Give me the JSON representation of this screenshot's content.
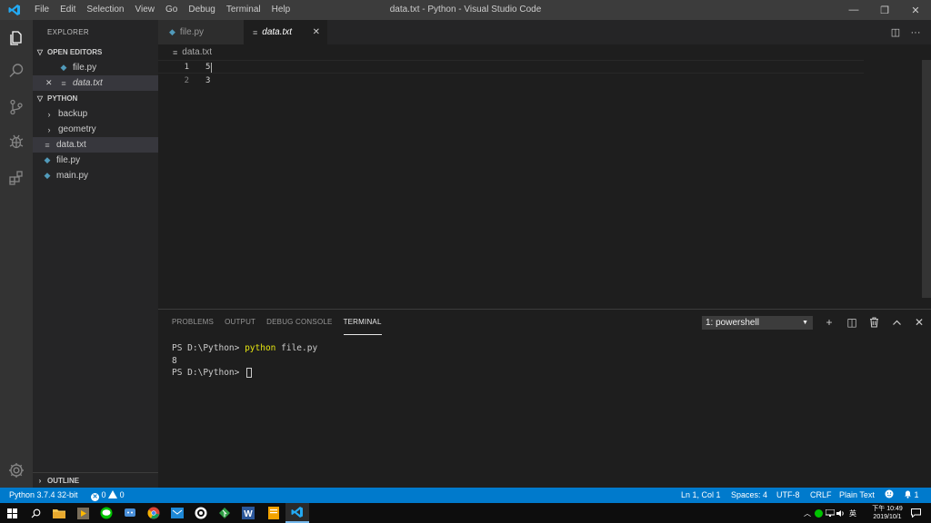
{
  "titlebar": {
    "menu": [
      "File",
      "Edit",
      "Selection",
      "View",
      "Go",
      "Debug",
      "Terminal",
      "Help"
    ],
    "title": "data.txt - Python - Visual Studio Code",
    "min_glyph": "—",
    "restore_glyph": "❐",
    "close_glyph": "✕",
    "logo_icon": "vscode-logo-icon"
  },
  "activitybar": {
    "items": [
      "explorer-icon",
      "search-icon",
      "source-control-icon",
      "debug-icon",
      "extensions-icon"
    ],
    "bottom": "gear-icon"
  },
  "sidebar": {
    "title": "EXPLORER",
    "open_editors": {
      "header": "OPEN EDITORS",
      "items": [
        {
          "name": "file.py",
          "icon": "python-file-icon"
        },
        {
          "name": "data.txt",
          "icon": "text-file-icon",
          "close": "✕"
        }
      ]
    },
    "workspace": {
      "header": "PYTHON",
      "items": [
        {
          "name": "backup",
          "type": "folder"
        },
        {
          "name": "geometry",
          "type": "folder"
        },
        {
          "name": "data.txt",
          "type": "text",
          "selected": true
        },
        {
          "name": "file.py",
          "type": "python"
        },
        {
          "name": "main.py",
          "type": "python"
        }
      ]
    },
    "outline": "OUTLINE"
  },
  "tabs": [
    {
      "label": "file.py",
      "active": false
    },
    {
      "label": "data.txt",
      "active": true,
      "close": "✕"
    }
  ],
  "editor_actions": {
    "split": "◫",
    "more": "···"
  },
  "breadcrumb": "data.txt",
  "editor": {
    "lines": [
      {
        "number": "1",
        "text": "5"
      },
      {
        "number": "2",
        "text": "3"
      }
    ]
  },
  "panel": {
    "tabs": [
      "PROBLEMS",
      "OUTPUT",
      "DEBUG CONSOLE",
      "TERMINAL"
    ],
    "active_tab": "TERMINAL",
    "terminal_select": "1: powershell",
    "select_arrow": "▼",
    "actions": {
      "add": "+",
      "split": "◫",
      "trash": "🗑",
      "maximize": "︿",
      "close": "✕"
    },
    "terminal": {
      "line1_prompt": "PS D:\\Python> ",
      "line1_cmd": "python",
      "line1_args": " file.py",
      "line2": "8",
      "line3_prompt": "PS D:\\Python> "
    }
  },
  "statusbar": {
    "interpreter": "Python 3.7.4 32-bit",
    "errors": "0",
    "warnings": "0",
    "cursor": "Ln 1, Col 1",
    "spaces": "Spaces: 4",
    "encoding": "UTF-8",
    "eol": "CRLF",
    "language": "Plain Text",
    "feedback_icon": "smiley-icon",
    "bell_icon": "bell-icon",
    "notifications": "1"
  },
  "taskbar": {
    "clock_top": "下午 10:49",
    "clock_date": "2019/10/1",
    "ime": "英",
    "colors": {
      "accent": "#007acc",
      "tab_active_border": "#76b9ed"
    }
  }
}
